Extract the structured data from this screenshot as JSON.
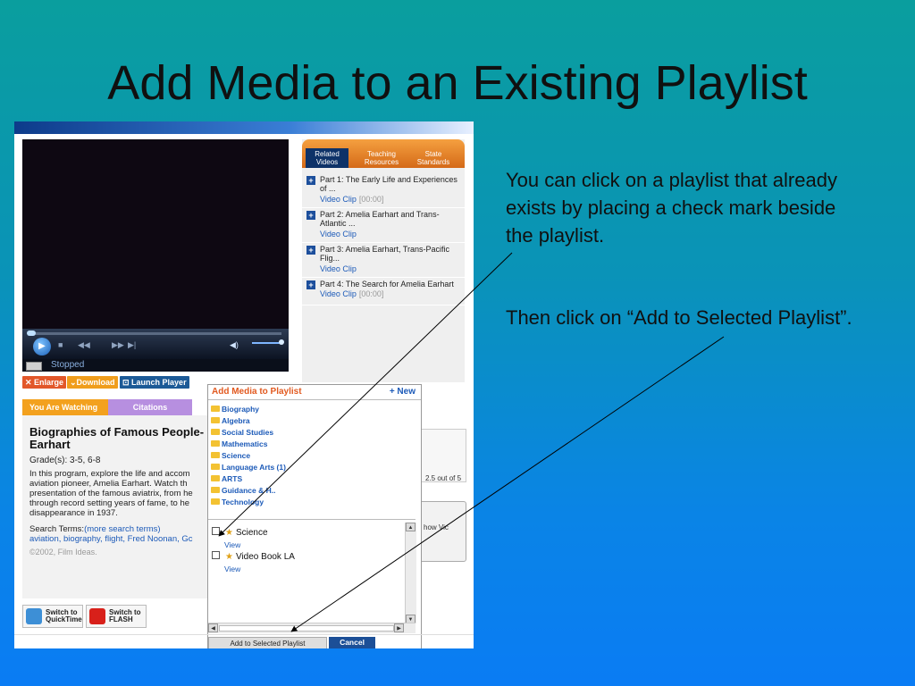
{
  "slide": {
    "title": "Add Media to an Existing Playlist",
    "note1": "You can click on a playlist that already exists by placing a check mark beside the playlist.",
    "note2": "Then click on “Add to Selected Playlist”."
  },
  "player": {
    "status": "Stopped",
    "controls": [
      "◀◀",
      "▶▶",
      "▶|"
    ],
    "buttons": {
      "enlarge": "✕ Enlarge",
      "download": "⌄Download",
      "launch": "⊡ Launch Player"
    }
  },
  "related": {
    "tabs": [
      "Related Videos",
      "Teaching Resources",
      "State Standards"
    ],
    "items": [
      {
        "title": "Part 1: The Early Life and Experiences of ...",
        "clip": "Video Clip",
        "dur": "[00:00]"
      },
      {
        "title": "Part 2: Amelia Earhart and Trans-Atlantic ...",
        "clip": "Video Clip",
        "dur": ""
      },
      {
        "title": "Part 3: Amelia Earhart, Trans-Pacific Flig...",
        "clip": "Video Clip",
        "dur": ""
      },
      {
        "title": "Part 4: The Search for Amelia Earhart",
        "clip": "Video Clip",
        "dur": "[00:00]"
      }
    ]
  },
  "info": {
    "tabs": [
      "You Are Watching",
      "Citations"
    ],
    "title": "Biographies of Famous People-Earhart",
    "grade": "Grade(s): 3-5, 6-8",
    "desc": "In this program, explore the life and accom\naviation pioneer, Amelia Earhart. Watch th\npresentation of the famous aviatrix, from he\nthrough record setting years of fame, to he\ndisappearance in 1937.",
    "search_label": "Search Terms:",
    "more_terms": "(more search terms)",
    "terms": "aviation, biography, flight, Fred Noonan, Gc",
    "copyright": "©2002, Film Ideas.",
    "switch_qt": "Switch to QuickTime",
    "switch_flash": "Switch to FLASH",
    "rating": "2.5 out of 5",
    "show": "how Vic"
  },
  "dialog": {
    "title": "Add Media to Playlist",
    "new": "+ New",
    "categories": [
      "Biography",
      "Algebra",
      "Social Studies",
      "Mathematics",
      "Science",
      "Language Arts (1)",
      "ARTS",
      "Guidance & H..",
      "Technology"
    ],
    "playlists": [
      {
        "name": "Science",
        "view": "View"
      },
      {
        "name": "Video Book LA",
        "view": "View"
      }
    ],
    "add_button": "Add to Selected Playlist",
    "cancel_button": "Cancel"
  },
  "colors": {
    "accent": "#e25a20",
    "link": "#1c5ab8",
    "tab_orange": "#f3a11e"
  }
}
